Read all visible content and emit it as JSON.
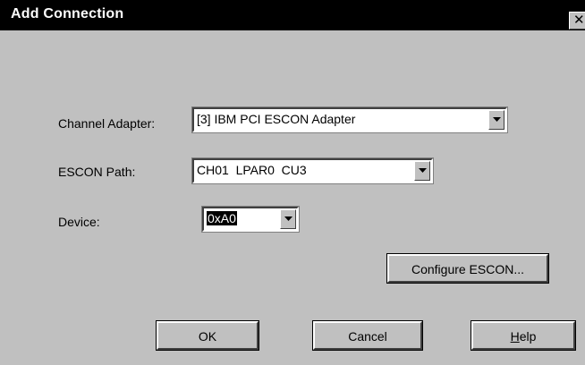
{
  "window": {
    "title": "Add Connection",
    "close_glyph": "✕"
  },
  "form": {
    "channel_adapter": {
      "label": "Channel Adapter:",
      "value": "[3] IBM PCI ESCON Adapter"
    },
    "escon_path": {
      "label": "ESCON Path:",
      "value": "CH01  LPAR0  CU3"
    },
    "device": {
      "label": "Device:",
      "value": "0xA0"
    }
  },
  "buttons": {
    "configure": "Configure ESCON...",
    "ok": "OK",
    "cancel": "Cancel",
    "help_hotkey": "H",
    "help_rest": "elp"
  },
  "icons": {
    "dropdown": "chevron-down-icon",
    "close": "close-icon"
  },
  "colors": {
    "face": "#c0c0c0",
    "titlebar": "#000000",
    "field": "#ffffff",
    "selection": "#000000"
  }
}
